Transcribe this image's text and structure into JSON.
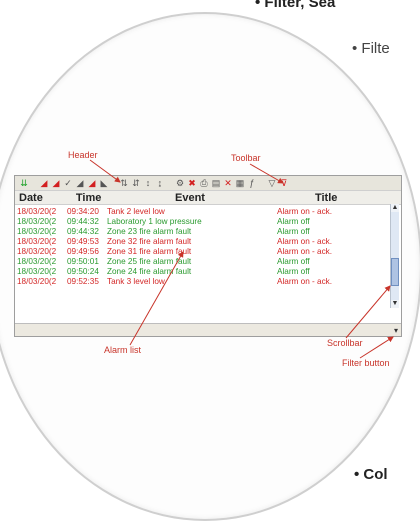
{
  "slide": {
    "bullet_top": "• Filter, Sea",
    "bullet_mid": "• Filte",
    "bullet_bottom": "• Col"
  },
  "labels": {
    "header": "Header",
    "toolbar": "Toolbar",
    "alarm_list": "Alarm list",
    "scrollbar": "Scrollbar",
    "filter_button": "Filter button"
  },
  "table": {
    "columns": [
      "Date",
      "Time",
      "Event",
      "Title"
    ],
    "rows": [
      {
        "date": "18/03/20(2",
        "time": "09:34:20",
        "event": "Tank 2 level low",
        "title": "Alarm on - ack.",
        "status": "red"
      },
      {
        "date": "18/03/20(2",
        "time": "09:44:32",
        "event": "Laboratory 1 low pressure",
        "title": "Alarm off",
        "status": "green"
      },
      {
        "date": "18/03/20(2",
        "time": "09:44:32",
        "event": "Zone 23 fire alarm fault",
        "title": "Alarm off",
        "status": "green"
      },
      {
        "date": "18/03/20(2",
        "time": "09:49:53",
        "event": "Zone 32 fire alarm fault",
        "title": "Alarm on - ack.",
        "status": "red"
      },
      {
        "date": "18/03/20(2",
        "time": "09:49:56",
        "event": "Zone 31 fire alarm fault",
        "title": "Alarm on - ack.",
        "status": "red"
      },
      {
        "date": "18/03/20(2",
        "time": "09:50:01",
        "event": "Zone 25 fire alarm fault",
        "title": "Alarm off",
        "status": "green"
      },
      {
        "date": "18/03/20(2",
        "time": "09:50:24",
        "event": "Zone 24 fire alarm fault",
        "title": "Alarm off",
        "status": "green"
      },
      {
        "date": "18/03/20(2",
        "time": "09:52:35",
        "event": "Tank 3 level low",
        "title": "Alarm on - ack.",
        "status": "red"
      }
    ]
  },
  "colors": {
    "alarm_on": "#d32727",
    "alarm_off": "#2a9a2f",
    "label_red": "#c8342a"
  }
}
